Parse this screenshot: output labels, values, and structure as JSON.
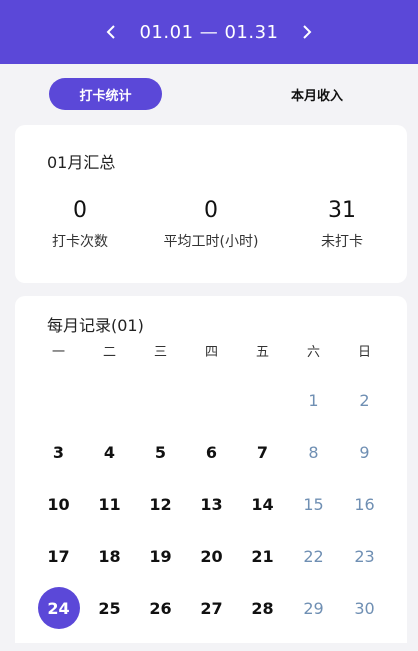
{
  "header": {
    "range": "01.01 — 01.31",
    "prev_icon": "chevron-left-icon",
    "next_icon": "chevron-right-icon",
    "accent_color": "#5b48d8"
  },
  "tabs": {
    "active": "打卡统计",
    "inactive": "本月收入"
  },
  "summary": {
    "title": "01月汇总",
    "stats": [
      {
        "value": "0",
        "label": "打卡次数"
      },
      {
        "value": "0",
        "label": "平均工时(小时)"
      },
      {
        "value": "31",
        "label": "未打卡"
      }
    ]
  },
  "calendar": {
    "title": "每月记录(01)",
    "weekdays": [
      "一",
      "二",
      "三",
      "四",
      "五",
      "六",
      "日"
    ],
    "leading_blanks": 5,
    "days": [
      "1",
      "2",
      "3",
      "4",
      "5",
      "6",
      "7",
      "8",
      "9",
      "10",
      "11",
      "12",
      "13",
      "14",
      "15",
      "16",
      "17",
      "18",
      "19",
      "20",
      "21",
      "22",
      "23",
      "24",
      "25",
      "26",
      "27",
      "28",
      "29",
      "30"
    ],
    "selected_day": "24",
    "weekend_color": "#6f8fb3"
  }
}
